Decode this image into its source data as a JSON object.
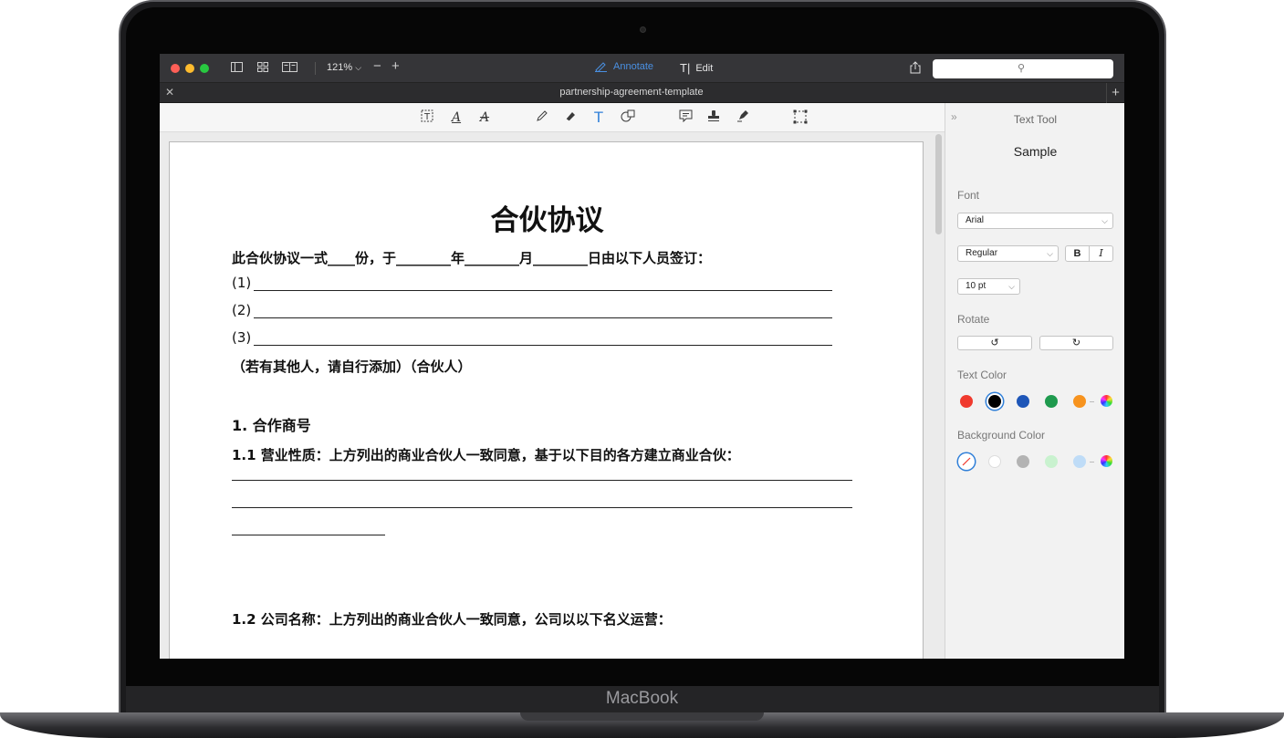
{
  "device": {
    "label": "MacBook"
  },
  "window": {
    "zoom": "121%",
    "modes": {
      "annotate": "Annotate",
      "edit": "Edit"
    },
    "tab_title": "partnership-agreement-template",
    "traffic_colors": [
      "#fe5f57",
      "#febc2e",
      "#28c840"
    ]
  },
  "toolbar": {
    "tools": [
      "text-box-tool",
      "underline-text-tool",
      "strikethrough-text-tool",
      "pencil-tool",
      "eraser-tool",
      "text-tool",
      "shape-tool",
      "note-tool",
      "stamp-tool",
      "signature-tool",
      "selection-tool"
    ],
    "active_tool": "text-tool",
    "accent": "#2f7fd8"
  },
  "document": {
    "title": "合伙协议",
    "intro": "此合伙协议一式____份，于________年________月________日由以下人员签订：",
    "party_lines": [
      "(1)",
      "(2)",
      "(3)"
    ],
    "note": "（若有其他人，请自行添加）（合伙人）",
    "section_1": "1.  合作商号",
    "clause_1_1_label": "1.1 营业性质",
    "clause_1_1_text": "：上方列出的商业合伙人一致同意，基于以下目的各方建立商业合伙：",
    "clause_1_2_label": "1.2 公司名称",
    "clause_1_2_text": "：上方列出的商业合伙人一致同意，公司以以下名义运营："
  },
  "panel": {
    "title": "Text Tool",
    "sample": "Sample",
    "font_label": "Font",
    "font_value": "Arial",
    "style_value": "Regular",
    "bold_label": "B",
    "italic_label": "I",
    "size_value": "10 pt",
    "rotate_label": "Rotate",
    "text_color_label": "Text Color",
    "text_colors": [
      "#f03a2e",
      "#000000",
      "#1e56b8",
      "#1f9a4e",
      "#f7931e"
    ],
    "selected_text_color": "#000000",
    "background_color_label": "Background Color",
    "background_colors": [
      "#ffffff",
      "#b3b3b3",
      "#c9f2cf",
      "#bfdcf7"
    ]
  }
}
